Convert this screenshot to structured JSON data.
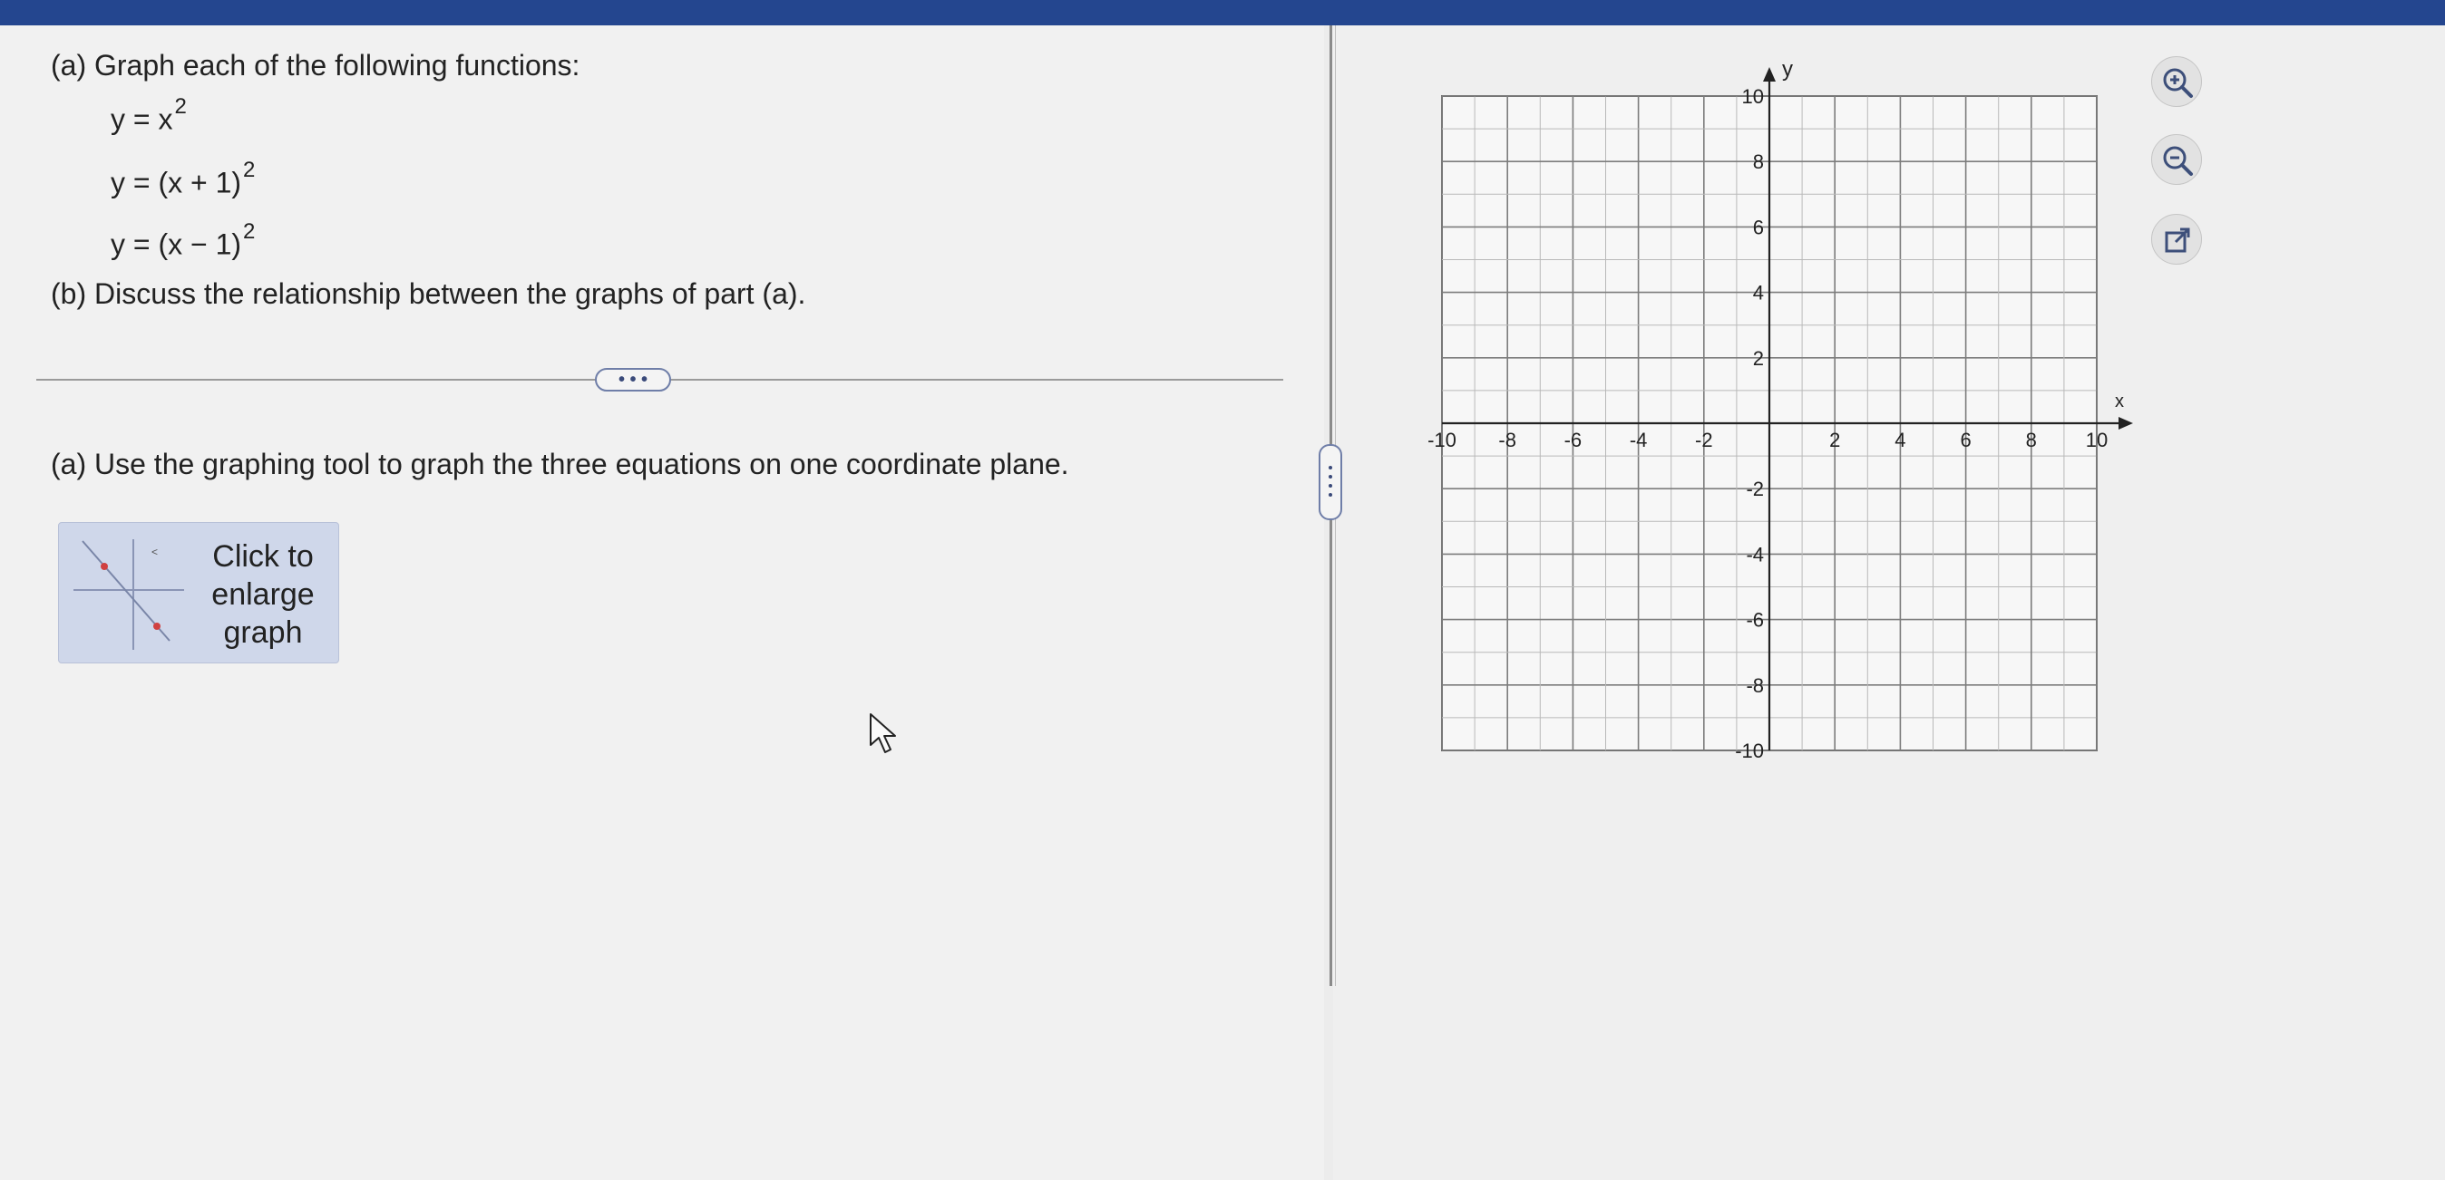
{
  "part_a_prompt": "(a) Graph each of the following functions:",
  "equations": [
    {
      "lhs": "y = x",
      "exp": "2"
    },
    {
      "lhs": "y = (x + 1)",
      "exp": "2"
    },
    {
      "lhs": "y = (x − 1)",
      "exp": "2"
    }
  ],
  "part_b_prompt": "(b) Discuss the relationship between the graphs of part (a).",
  "more_label": "• • •",
  "instruction": "(a) Use the graphing tool to graph the three equations on one coordinate plane.",
  "enlarge": {
    "line1": "Click to",
    "line2": "enlarge",
    "line3": "graph"
  },
  "graph": {
    "x_label": "x",
    "y_label": "y",
    "x_ticks": [
      "-10",
      "-8",
      "-6",
      "-4",
      "-2",
      "2",
      "4",
      "6",
      "8",
      "10"
    ],
    "y_ticks": [
      "10",
      "8",
      "6",
      "4",
      "2",
      "-2",
      "-4",
      "-6",
      "-8",
      "-10"
    ],
    "range": [
      -10,
      10
    ]
  },
  "tools": [
    {
      "name": "zoom-in-icon"
    },
    {
      "name": "zoom-out-icon"
    },
    {
      "name": "popout-icon"
    }
  ]
}
